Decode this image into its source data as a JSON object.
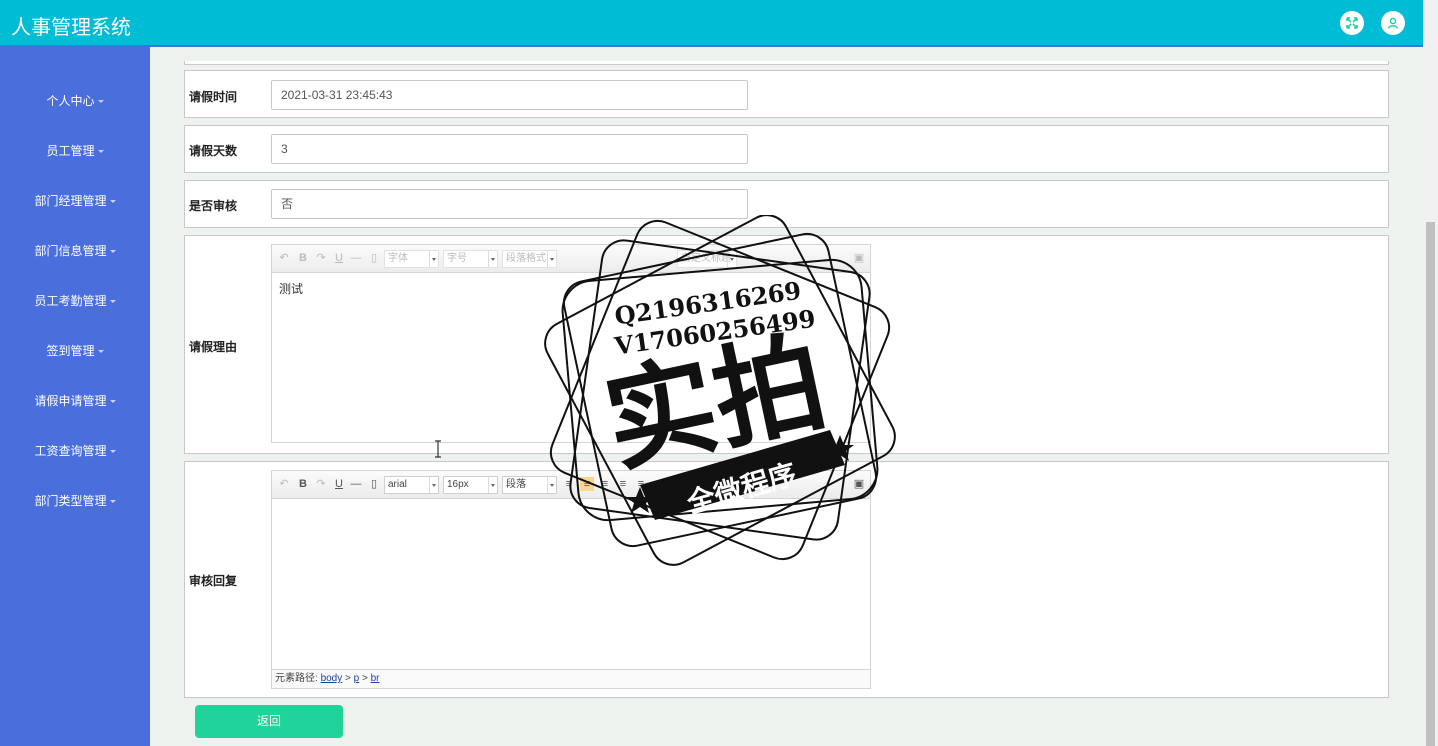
{
  "app": {
    "title": "人事管理系统"
  },
  "header": {
    "icons": [
      "fullscreen-icon",
      "user-icon"
    ]
  },
  "sidebar": {
    "items": [
      {
        "label": "个人中心"
      },
      {
        "label": "员工管理"
      },
      {
        "label": "部门经理管理"
      },
      {
        "label": "部门信息管理"
      },
      {
        "label": "员工考勤管理"
      },
      {
        "label": "签到管理"
      },
      {
        "label": "请假申请管理"
      },
      {
        "label": "工资查询管理"
      },
      {
        "label": "部门类型管理"
      }
    ]
  },
  "form": {
    "leave_time": {
      "label": "请假时间",
      "value": "2021-03-31 23:45:43"
    },
    "leave_days": {
      "label": "请假天数",
      "value": "3"
    },
    "reviewed": {
      "label": "是否审核",
      "value": "否"
    },
    "reason": {
      "label": "请假理由",
      "content": "测试",
      "toolbar": {
        "font": "字体",
        "size": "字号",
        "paragraph": "段落格式",
        "custom_title": "自定义标题"
      }
    },
    "reply": {
      "label": "审核回复",
      "toolbar": {
        "font": "arial",
        "size": "16px",
        "paragraph": "段落"
      },
      "path_label": "元素路径:",
      "path": [
        "body",
        "p",
        "br"
      ]
    }
  },
  "actions": {
    "back_label": "返回"
  },
  "watermark": {
    "line1": "Q2196316269",
    "line2": "V17060256499",
    "main": "实拍",
    "banner": "全微程序"
  },
  "colors": {
    "header": "#00bcd4",
    "sidebar": "#4a6fdc",
    "button": "#1fd39b",
    "background": "#eef2ef"
  }
}
